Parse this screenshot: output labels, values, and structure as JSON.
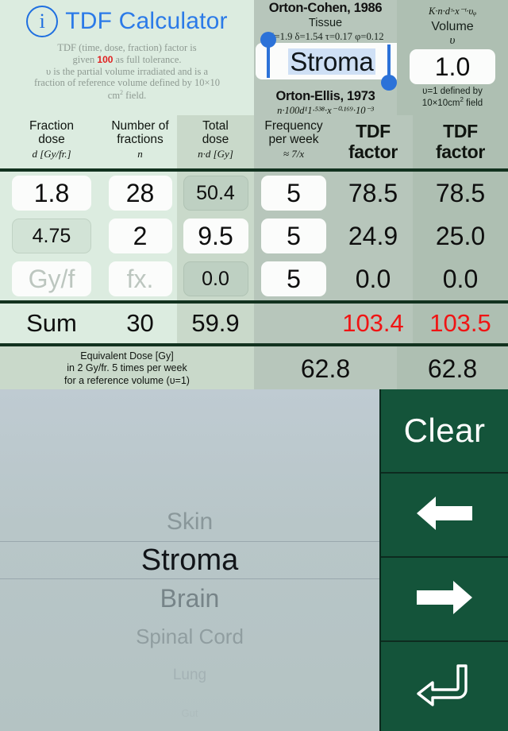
{
  "header": {
    "app_title": "TDF Calculator",
    "info_icon": "info-circle-icon",
    "blurb_line1": "TDF (time, dose, fraction) factor is",
    "blurb_line2_pre": "given ",
    "blurb_full_tolerance": "100",
    "blurb_line2_post": " as full tolerance.",
    "blurb_line3": "υ is the partial volume irradiated and is a",
    "blurb_line4": "fraction of reference volume defined by 10×10",
    "blurb_line5": "cm",
    "blurb_line5_sup": "2",
    "blurb_line5_post": " field."
  },
  "middle": {
    "citation_1": "Orton-Cohen, 1986",
    "tissue_label": "Tissue",
    "constants": "K=1.9 δ=1.54 τ=0.17 φ=0.12",
    "tissue_value": "Stroma",
    "citation_2": "Orton-Ellis, 1973",
    "formula_2": "n·100d¹1·⁵³⁸·x⁻⁰·¹⁶⁹·10⁻³"
  },
  "right": {
    "formula_1": "K·n·dᶟ·x⁻ᵗ·υᵩ",
    "volume_label": "Volume",
    "volume_symbol": "υ",
    "volume_value": "1.0",
    "volume_note_1": "υ=1 defined by",
    "volume_note_2": "10×10cm",
    "volume_note_2_sup": "2",
    "volume_note_2_post": " field"
  },
  "table": {
    "columns": [
      {
        "line1": "Fraction",
        "line2": "dose",
        "line3": "d [Gy/fr.]"
      },
      {
        "line1": "Number of",
        "line2": "fractions",
        "line3": "n"
      },
      {
        "line1": "Total",
        "line2": "dose",
        "line3": "n·d [Gy]"
      },
      {
        "line1": "Frequency",
        "line2": "per week",
        "line3": "≈ 7/x"
      },
      {
        "line1": "TDF",
        "line2": "factor",
        "line3": ""
      },
      {
        "line1": "TDF",
        "line2": "factor",
        "line3": ""
      }
    ],
    "rows": [
      {
        "fraction_dose": "1.8",
        "fraction_dose_mode": "input",
        "num_fractions": "28",
        "num_fractions_mode": "input",
        "total_dose": "50.4",
        "total_dose_mode": "calc",
        "frequency": "5",
        "frequency_mode": "input",
        "tdf_cohen": "78.5",
        "tdf_ellis": "78.5"
      },
      {
        "fraction_dose": "4.75",
        "fraction_dose_mode": "calc",
        "num_fractions": "2",
        "num_fractions_mode": "input",
        "total_dose": "9.5",
        "total_dose_mode": "input",
        "frequency": "5",
        "frequency_mode": "input",
        "tdf_cohen": "24.9",
        "tdf_ellis": "25.0"
      },
      {
        "fraction_dose": "Gy/f",
        "fraction_dose_mode": "placeholder",
        "num_fractions": "fx.",
        "num_fractions_mode": "placeholder",
        "total_dose": "0.0",
        "total_dose_mode": "calc",
        "frequency": "5",
        "frequency_mode": "input",
        "tdf_cohen": "0.0",
        "tdf_ellis": "0.0"
      }
    ],
    "sum": {
      "label": "Sum",
      "num_fractions": "30",
      "total_dose": "59.9",
      "frequency": "",
      "tdf_cohen": "103.4",
      "tdf_ellis": "103.5",
      "over_tolerance_color": "#f01414"
    },
    "equivalent": {
      "line1": "Equivalent Dose [Gy]",
      "line2": "in 2 Gy/fr. 5 times per week",
      "line3": "for a reference volume (υ=1)",
      "value_cohen": "62.8",
      "value_ellis": "62.8"
    }
  },
  "picker": {
    "name": "tissue-picker-wheel",
    "selected": "Stroma",
    "items": [
      {
        "label": "Skin",
        "size": 30,
        "color": "#7d8a8e",
        "opacity": 0.78
      },
      {
        "label": "Stroma",
        "size": 38,
        "color": "#111418",
        "opacity": 1.0
      },
      {
        "label": "Brain",
        "size": 32,
        "color": "#69767b",
        "opacity": 0.82
      },
      {
        "label": "Spinal Cord",
        "size": 26,
        "color": "#7d8a8e",
        "opacity": 0.66
      },
      {
        "label": "Lung",
        "size": 19,
        "color": "#93a0a4",
        "opacity": 0.5
      },
      {
        "label": "Gut",
        "size": 13,
        "color": "#a3b0b3",
        "opacity": 0.36
      }
    ]
  },
  "keypad": {
    "clear_label": "Clear",
    "left_icon": "arrow-left-icon",
    "right_icon": "arrow-right-icon",
    "return_icon": "return-arrow-icon",
    "key_color": "#14543a"
  }
}
